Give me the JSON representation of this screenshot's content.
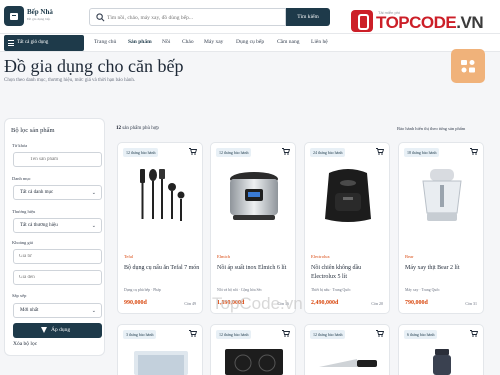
{
  "header": {
    "brand_name": "Bếp Nhà",
    "brand_sub": "Đồ gia dụng bếp",
    "search_placeholder": "Tìm nồi, chảo, máy xay, đồ dùng bếp...",
    "search_button": "Tìm kiếm"
  },
  "watermark": {
    "small": "Tải miễn phí",
    "brand_red": "TOPCODE",
    "brand_dark": ".VN",
    "page_mark": "TopCode.vn"
  },
  "nav": {
    "category_button": "Tất cả giỏ dụng",
    "items": [
      "Trang chủ",
      "Sản phẩm",
      "Nồi",
      "Chảo",
      "Máy xay",
      "Dụng cụ bếp",
      "Cầm nang",
      "Liên hệ"
    ],
    "active_index": 1
  },
  "page": {
    "title": "Đồ gia dụng cho căn bếp",
    "subtitle": "Chọn theo danh mục, thương hiệu, mức giá và thời hạn bảo hành."
  },
  "filters": {
    "title": "Bộ lọc sản phẩm",
    "keyword_label": "Từ khóa",
    "keyword_placeholder": "Tên sản phẩm",
    "category_label": "Danh mục",
    "category_value": "Tất cả danh mục",
    "brand_label": "Thương hiệu",
    "brand_value": "Tất cả thương hiệu",
    "price_label": "Khoảng giá",
    "price_from_placeholder": "Giá từ",
    "price_to_placeholder": "Giá đến",
    "sort_label": "Sắp xếp",
    "sort_value": "Mới nhất",
    "apply_button": "Áp dụng",
    "clear_link": "Xóa bộ lọc"
  },
  "results": {
    "count": "12",
    "count_suffix": "sản phẩm phù hợp",
    "sort_hint": "Bảo hành hiển thị theo từng sản phẩm"
  },
  "products": [
    {
      "warranty": "12 tháng bảo hành",
      "brand": "Tefal",
      "name": "Bộ dụng cụ nấu ăn Tefal 7 món",
      "meta": "Dụng cụ phủ bếp · Pháp",
      "price": "990,000đ",
      "stock": "Còn 49",
      "image": "utensils-set"
    },
    {
      "warranty": "12 tháng bảo hành",
      "brand": "Elmich",
      "name": "Nồi áp suất inox Elmich 6 lít",
      "meta": "Nồi và bộ nồi · Cộng hòa Séc",
      "price": "1,890,000đ",
      "stock": "Còn 16",
      "image": "pressure-cooker"
    },
    {
      "warranty": "24 tháng bảo hành",
      "brand": "Electrolux",
      "name": "Nồi chiên không dầu Electrolux 5 lít",
      "meta": "Thiết bị nấu · Trung Quốc",
      "price": "2,490,000đ",
      "stock": "Còn 20",
      "image": "air-fryer"
    },
    {
      "warranty": "18 tháng bảo hành",
      "brand": "Bear",
      "name": "Máy xay thịt Bear 2 lít",
      "meta": "Máy xay · Trung Quốc",
      "price": "790,000đ",
      "stock": "Còn 31",
      "image": "meat-grinder"
    },
    {
      "warranty": "3 tháng bảo hành",
      "image": "induction-cooker"
    },
    {
      "warranty": "12 tháng bảo hành",
      "image": "induction-hob"
    },
    {
      "warranty": "12 tháng bảo hành",
      "image": "knife"
    },
    {
      "warranty": "6 tháng bảo hành",
      "image": "thermos"
    }
  ],
  "colors": {
    "primary": "#1e3a4a",
    "accent": "#d9480f",
    "fab": "#f0b27a"
  }
}
